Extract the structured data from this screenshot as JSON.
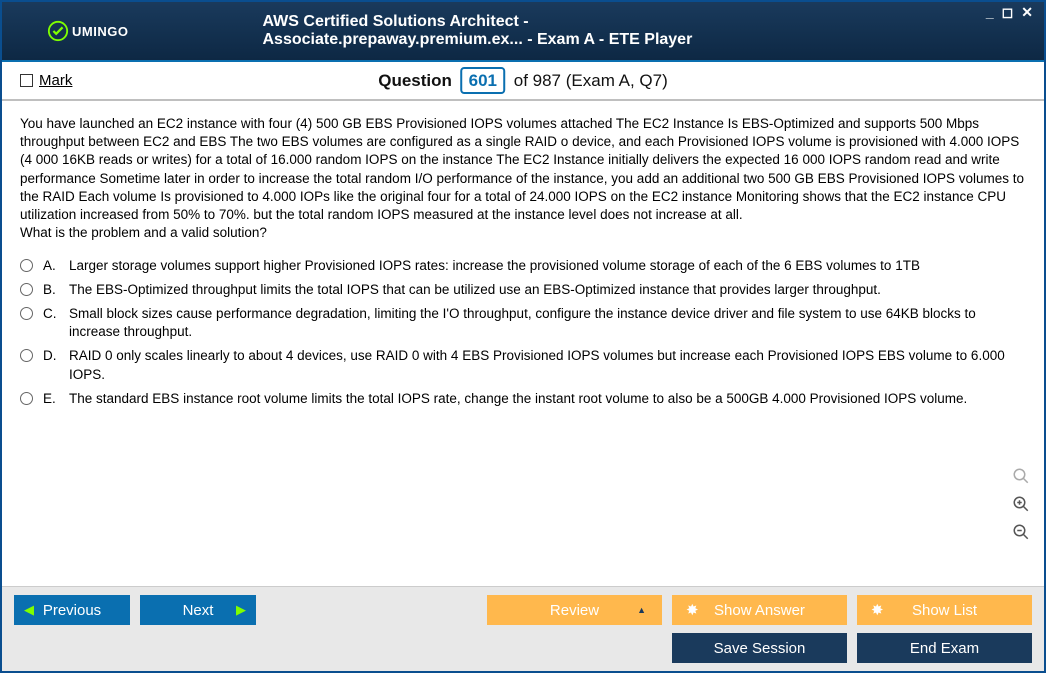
{
  "window": {
    "logo_text": "UMINGO",
    "title": "AWS Certified Solutions Architect - Associate.prepaway.premium.ex... - Exam A - ETE Player"
  },
  "header": {
    "mark_label": "Mark",
    "question_label": "Question",
    "current_number": "601",
    "total_suffix": "of 987 (Exam A, Q7)"
  },
  "question": {
    "text": "You have launched an EC2 instance with four (4) 500 GB EBS Provisioned IOPS volumes attached The EC2 Instance Is EBS-Optimized and supports 500 Mbps throughput between EC2 and EBS The two EBS volumes are configured as a single RAID o device, and each Provisioned IOPS volume is provisioned with 4.000 IOPS (4 000 16KB reads or writes) for a total of 16.000 random IOPS on the instance The EC2 Instance initially delivers the expected 16 000 IOPS random read and write performance Sometime later in order to increase the total random I/O performance of the instance, you add an additional two 500 GB EBS Provisioned IOPS volumes to the RAID Each volume Is provisioned to 4.000 IOPs like the original four for a total of 24.000 IOPS on the EC2 instance Monitoring shows that the EC2 instance CPU utilization increased from 50% to 70%. but the total random IOPS measured at the instance level does not increase at all.\nWhat is the problem and a valid solution?"
  },
  "options": [
    {
      "letter": "A.",
      "text": "Larger storage volumes support higher Provisioned IOPS rates: increase the provisioned volume storage of each of the 6 EBS volumes to 1TB"
    },
    {
      "letter": "B.",
      "text": "The EBS-Optimized throughput limits the total IOPS that can be utilized use an EBS-Optimized instance that provides larger throughput."
    },
    {
      "letter": "C.",
      "text": "Small block sizes cause performance degradation, limiting the I'O throughput, configure the instance device driver and file system to use 64KB blocks to increase throughput."
    },
    {
      "letter": "D.",
      "text": "RAID 0 only scales linearly to about 4 devices, use RAID 0 with 4 EBS Provisioned IOPS volumes but increase each Provisioned IOPS EBS volume to 6.000 IOPS."
    },
    {
      "letter": "E.",
      "text": "The standard EBS instance root volume limits the total IOPS rate, change the instant root volume to also be a 500GB 4.000 Provisioned IOPS volume."
    }
  ],
  "footer": {
    "previous": "Previous",
    "next": "Next",
    "review": "Review",
    "show_answer": "Show Answer",
    "show_list": "Show List",
    "save_session": "Save Session",
    "end_exam": "End Exam"
  }
}
